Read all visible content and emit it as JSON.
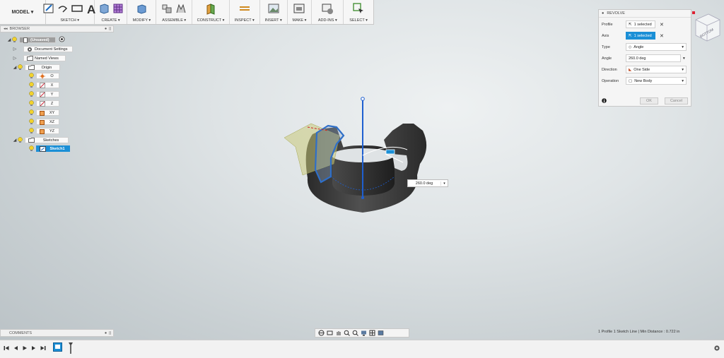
{
  "toolbar": {
    "mode": "MODEL",
    "groups": [
      {
        "label": "SKETCH ▾"
      },
      {
        "label": "CREATE ▾"
      },
      {
        "label": "MODIFY ▾"
      },
      {
        "label": "ASSEMBLE ▾"
      },
      {
        "label": "CONSTRUCT ▾"
      },
      {
        "label": "INSPECT ▾"
      },
      {
        "label": "INSERT ▾"
      },
      {
        "label": "MAKE ▾"
      },
      {
        "label": "ADD-INS ▾"
      },
      {
        "label": "SELECT ▾"
      }
    ]
  },
  "browser": {
    "title": "BROWSER",
    "root": "(Unsaved)",
    "items": {
      "doc_settings": "Document Settings",
      "named_views": "Named Views",
      "origin": "Origin",
      "o": "O",
      "x": "X",
      "y": "Y",
      "z": "Z",
      "xy": "XY",
      "xz": "XZ",
      "yz": "YZ",
      "sketches": "Sketches",
      "sketch1": "Sketch1"
    }
  },
  "revolve": {
    "title": "REVOLVE",
    "profile_label": "Profile",
    "profile_value": "1 selected",
    "axis_label": "Axis",
    "axis_value": "1 selected",
    "type_label": "Type",
    "type_value": "Angle",
    "angle_label": "Angle",
    "angle_value": "260.0 deg",
    "direction_label": "Direction",
    "direction_value": "One Side",
    "operation_label": "Operation",
    "operation_value": "New Body",
    "ok": "OK",
    "cancel": "Cancel"
  },
  "viewport": {
    "dimension_value": "260.0 deg",
    "viewcube_face": "BOTTOM"
  },
  "comments": {
    "title": "COMMENTS"
  },
  "status": {
    "text": "1 Profile 1 Sketch Line | Min Distance : 0.722 in"
  },
  "colors": {
    "accent": "#1b8fd6",
    "body": "#3a3a3a",
    "sketch_plane": "#c9c97a"
  }
}
